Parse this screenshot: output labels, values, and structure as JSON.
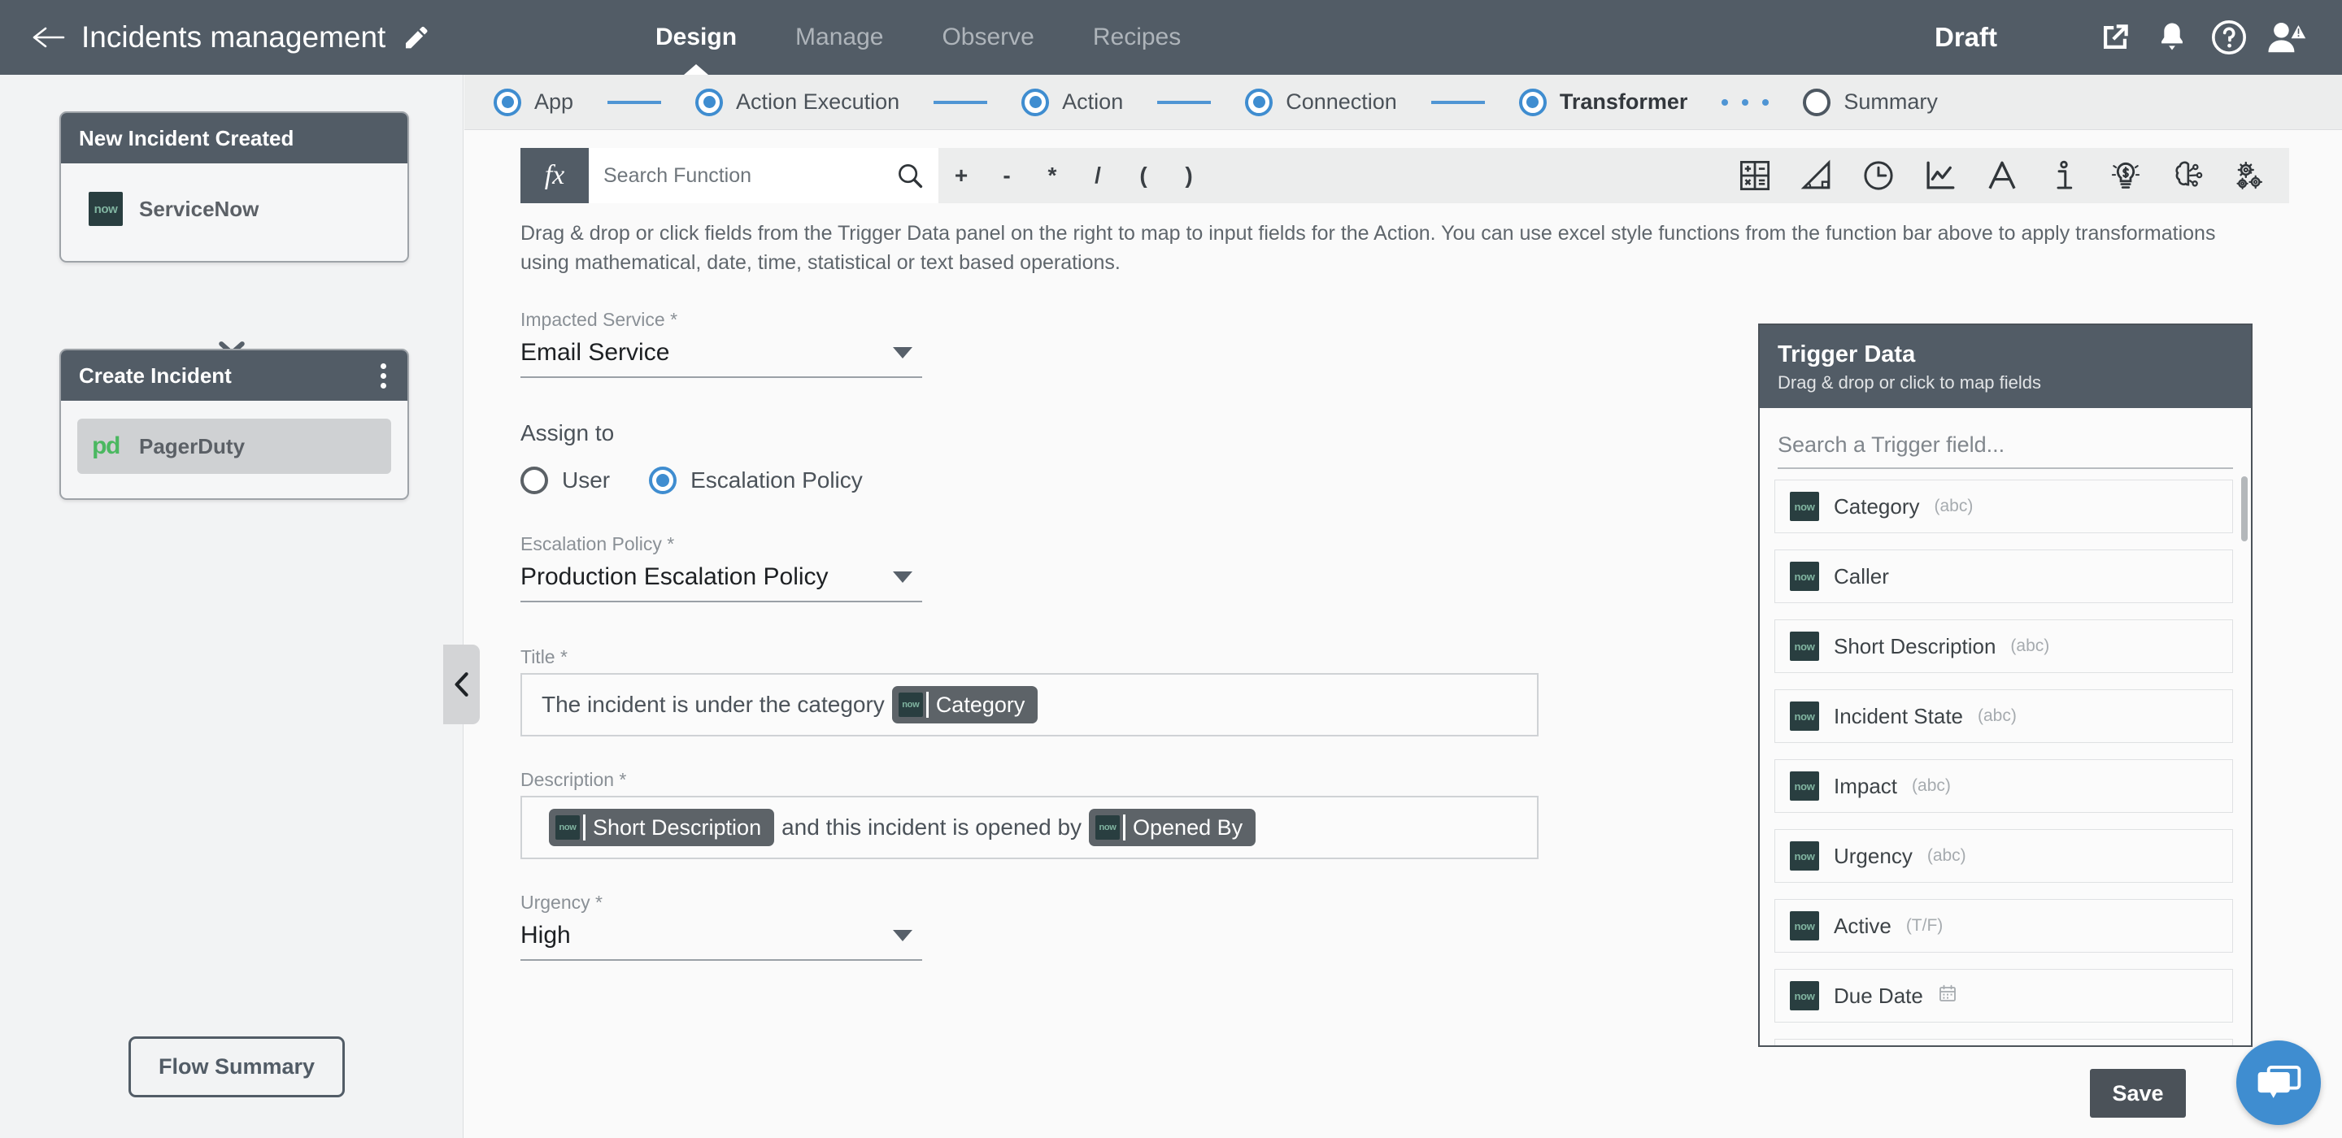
{
  "header": {
    "back_icon": "arrow-left-icon",
    "title": "Incidents management",
    "edit_icon": "pencil-icon",
    "tabs": [
      {
        "label": "Design",
        "active": true
      },
      {
        "label": "Manage",
        "active": false
      },
      {
        "label": "Observe",
        "active": false
      },
      {
        "label": "Recipes",
        "active": false
      }
    ],
    "status": "Draft",
    "icons": [
      "external-link-icon",
      "bell-icon",
      "help-circle-icon",
      "user-avatar-warning-icon"
    ]
  },
  "stepper": {
    "steps": [
      {
        "label": "App",
        "state": "done",
        "active": false
      },
      {
        "label": "Action Execution",
        "state": "done",
        "active": false
      },
      {
        "label": "Action",
        "state": "done",
        "active": false
      },
      {
        "label": "Connection",
        "state": "done",
        "active": false
      },
      {
        "label": "Transformer",
        "state": "done",
        "active": true
      },
      {
        "label": "Summary",
        "state": "empty",
        "active": false
      }
    ]
  },
  "sidebar": {
    "cards": [
      {
        "title": "New Incident Created",
        "has_kebab": false,
        "app": {
          "name": "ServiceNow",
          "logo": "now",
          "selected": false
        }
      },
      {
        "title": "Create Incident",
        "has_kebab": true,
        "app": {
          "name": "PagerDuty",
          "logo": "pd",
          "selected": true
        }
      }
    ],
    "connector_icon": "double-chevron-down-icon",
    "flow_summary_label": "Flow Summary",
    "collapse_icon": "chevron-left-icon"
  },
  "function_bar": {
    "fx_label": "fx",
    "search_placeholder": "Search Function",
    "search_icon": "search-icon",
    "operators": [
      "+",
      "-",
      "*",
      "/",
      "(",
      ")"
    ],
    "category_icons": [
      "calculator-icon",
      "trigonometry-icon",
      "clock-icon",
      "line-chart-icon",
      "text-a-icon",
      "info-icon",
      "finance-bulb-icon",
      "brain-ai-icon",
      "gears-icon"
    ]
  },
  "instruction": "Drag & drop or click fields from the Trigger Data panel on the right to map to input fields for the Action. You can use excel style functions from the function bar above to apply transformations using mathematical, date, time, statistical or text based operations.",
  "form": {
    "impacted_service": {
      "label": "Impacted Service *",
      "value": "Email Service"
    },
    "assign_to": {
      "label": "Assign to",
      "options": [
        {
          "label": "User",
          "selected": false
        },
        {
          "label": "Escalation Policy",
          "selected": true
        }
      ]
    },
    "escalation_policy": {
      "label": "Escalation Policy *",
      "value": "Production Escalation Policy"
    },
    "title": {
      "label": "Title *",
      "parts": [
        {
          "kind": "text",
          "value": "The incident is under the category "
        },
        {
          "kind": "chip",
          "value": "Category",
          "logo": "now"
        }
      ]
    },
    "description": {
      "label": "Description *",
      "parts": [
        {
          "kind": "chip",
          "value": "Short Description",
          "logo": "now"
        },
        {
          "kind": "text",
          "value": " and this incident is opened by "
        },
        {
          "kind": "chip",
          "value": "Opened By",
          "logo": "now"
        }
      ]
    },
    "urgency": {
      "label": "Urgency *",
      "value": "High"
    }
  },
  "trigger_panel": {
    "title": "Trigger Data",
    "subtitle": "Drag & drop or click to map fields",
    "search_placeholder": "Search a Trigger field...",
    "fields": [
      {
        "name": "Category",
        "type": "(abc)",
        "logo": "now"
      },
      {
        "name": "Caller",
        "type": "",
        "logo": "now"
      },
      {
        "name": "Short Description",
        "type": "(abc)",
        "logo": "now"
      },
      {
        "name": "Incident State",
        "type": "(abc)",
        "logo": "now"
      },
      {
        "name": "Impact",
        "type": "(abc)",
        "logo": "now"
      },
      {
        "name": "Urgency",
        "type": "(abc)",
        "logo": "now"
      },
      {
        "name": "Active",
        "type": "(T/F)",
        "logo": "now"
      },
      {
        "name": "Due Date",
        "type": "calendar-icon",
        "logo": "now"
      }
    ]
  },
  "footer": {
    "save_label": "Save",
    "chat_icon": "chat-bubble-icon"
  },
  "colors": {
    "header_bg": "#525c66",
    "accent_blue": "#3f8dd0",
    "servicenow_green": "#81b5a1",
    "pagerduty_green": "#4ab860"
  }
}
